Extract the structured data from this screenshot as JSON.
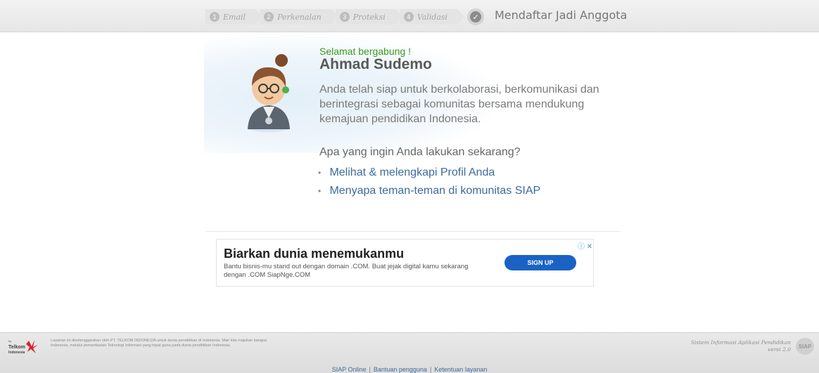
{
  "steps": [
    {
      "num": "1",
      "label": "Email"
    },
    {
      "num": "2",
      "label": "Perkenalan"
    },
    {
      "num": "3",
      "label": "Proteksi"
    },
    {
      "num": "4",
      "label": "Validasi"
    }
  ],
  "page_heading": "Mendaftar Jadi Anggota",
  "welcome": "Selamat bergabung !",
  "user_name": "Ahmad Sudemo",
  "intro": "Anda telah siap untuk berkolaborasi, berkomunikasi dan berintegrasi sebagai komunitas bersama mendukung kemajuan pendidikan Indonesia.",
  "question": "Apa yang ingin Anda lakukan sekarang?",
  "actions": [
    {
      "label": "Melihat & melengkapi Profil Anda"
    },
    {
      "label": "Menyapa teman-teman di komunitas SIAP"
    }
  ],
  "ad": {
    "title": "Biarkan dunia menemukanmu",
    "body": "Bantu bisnis-mu stand out dengan domain .COM. Buat jejak digital kamu sekarang dengan .COM SiapNge.COM",
    "button": "SIGN UP",
    "info_icon": "ⓘ",
    "close_icon": "✕"
  },
  "footer": {
    "logo_top": "by",
    "logo_name": "Telkom",
    "logo_sub": "Indonesia",
    "text": "Layanan ini diselenggarakan oleh PT. TELKOM INDONESIA untuk dunia pendidikan di Indonesia. Mari kita majukan bangsa Indonesia, melalui pemanfaatan Teknologi Informasi yang tepat guna pada dunia pendidikan Indonesia.",
    "system_name": "Sistem Informasi Aplikasi Pendidikan",
    "version": "versi 2.0",
    "mark": "SIAP",
    "links": [
      "SIAP Online",
      "Bantuan pengguna",
      "Ketentuan layanan"
    ]
  },
  "colors": {
    "welcome_green": "#3a9b1e",
    "link_blue": "#3d6b9d",
    "ad_button": "#1a63c5"
  }
}
